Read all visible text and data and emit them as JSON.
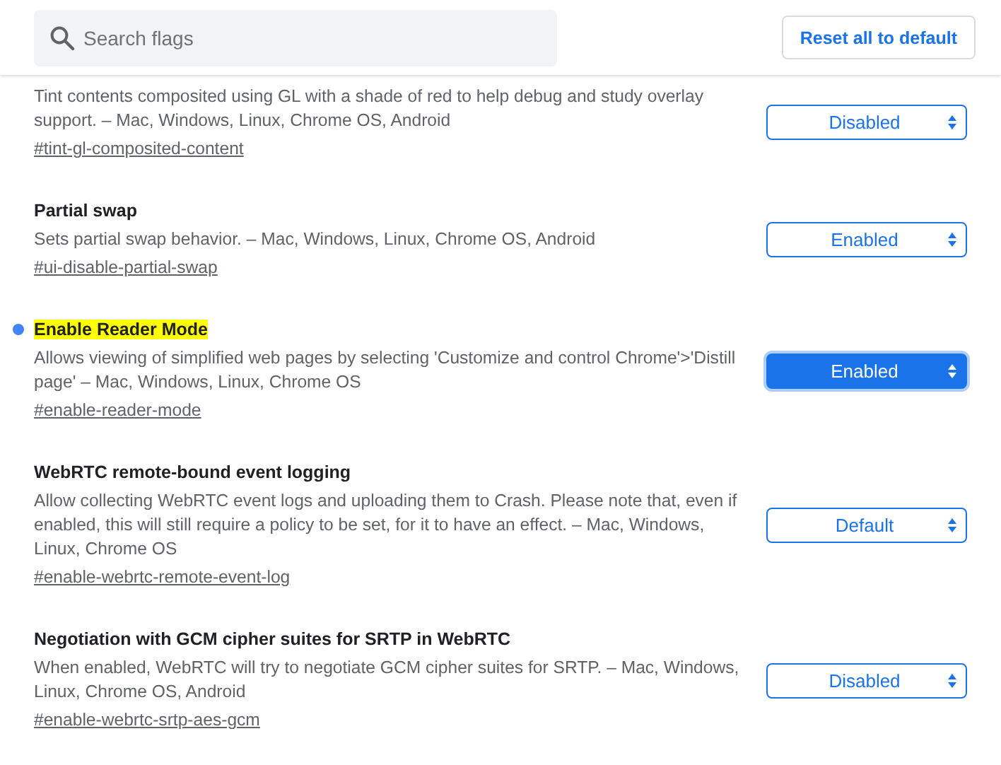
{
  "search": {
    "placeholder": "Search flags"
  },
  "reset_button": "Reset all to default",
  "flags": [
    {
      "description": "Tint contents composited using GL with a shade of red to help debug and study overlay support. – Mac, Windows, Linux, Chrome OS, Android",
      "link": "#tint-gl-composited-content",
      "value": "Disabled",
      "modified": false,
      "focused": false
    },
    {
      "title": "Partial swap",
      "description": "Sets partial swap behavior. – Mac, Windows, Linux, Chrome OS, Android",
      "link": "#ui-disable-partial-swap",
      "value": "Enabled",
      "modified": false,
      "highlighted": false,
      "focused": false
    },
    {
      "title": "Enable Reader Mode",
      "description": "Allows viewing of simplified web pages by selecting 'Customize and control Chrome'>'Distill page' – Mac, Windows, Linux, Chrome OS",
      "link": "#enable-reader-mode",
      "value": "Enabled",
      "modified": true,
      "highlighted": true,
      "focused": true
    },
    {
      "title": "WebRTC remote-bound event logging",
      "description": "Allow collecting WebRTC event logs and uploading them to Crash. Please note that, even if enabled, this will still require a policy to be set, for it to have an effect. – Mac, Windows, Linux, Chrome OS",
      "link": "#enable-webrtc-remote-event-log",
      "value": "Default",
      "modified": false,
      "highlighted": false,
      "focused": false
    },
    {
      "title": "Negotiation with GCM cipher suites for SRTP in WebRTC",
      "description": "When enabled, WebRTC will try to negotiate GCM cipher suites for SRTP. – Mac, Windows, Linux, Chrome OS, Android",
      "link": "#enable-webrtc-srtp-aes-gcm",
      "value": "Disabled",
      "modified": false,
      "highlighted": false,
      "focused": false
    }
  ]
}
